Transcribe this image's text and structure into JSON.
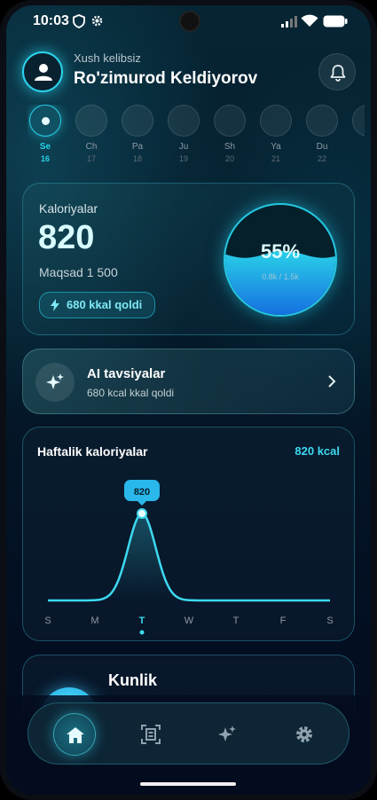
{
  "status_bar": {
    "time": "10:03"
  },
  "header": {
    "greeting": "Xush kelibsiz",
    "user_name": "Ro'zimurod Keldiyorov"
  },
  "days": [
    {
      "name": "Se",
      "num": "16",
      "active": true
    },
    {
      "name": "Ch",
      "num": "17"
    },
    {
      "name": "Pa",
      "num": "18"
    },
    {
      "name": "Ju",
      "num": "19"
    },
    {
      "name": "Sh",
      "num": "20"
    },
    {
      "name": "Ya",
      "num": "21"
    },
    {
      "name": "Du",
      "num": "22"
    }
  ],
  "calories": {
    "title": "Kaloriyalar",
    "value": "820",
    "goal": "Maqsad 1 500",
    "left_label": "680 kkal qoldi",
    "percent_label": "55%",
    "percent": 0.55,
    "progress_sub": "0.8k / 1.5k"
  },
  "ai": {
    "title": "AI tavsiyalar",
    "subtitle": "680 kcal kkal qoldi"
  },
  "weekly": {
    "title": "Haftalik kaloriyalar",
    "total": "820 kcal",
    "tooltip": "820",
    "days": [
      "S",
      "M",
      "T",
      "W",
      "T",
      "F",
      "S"
    ],
    "values": [
      0,
      0,
      820,
      0,
      0,
      0,
      0
    ],
    "active_index": 2
  },
  "daily": {
    "title": "Kunlik"
  },
  "colors": {
    "accent": "#29d3ec",
    "bg": "#041a2a"
  },
  "nav": [
    "home-icon",
    "scan-icon",
    "sparkle-icon",
    "settings-icon"
  ]
}
